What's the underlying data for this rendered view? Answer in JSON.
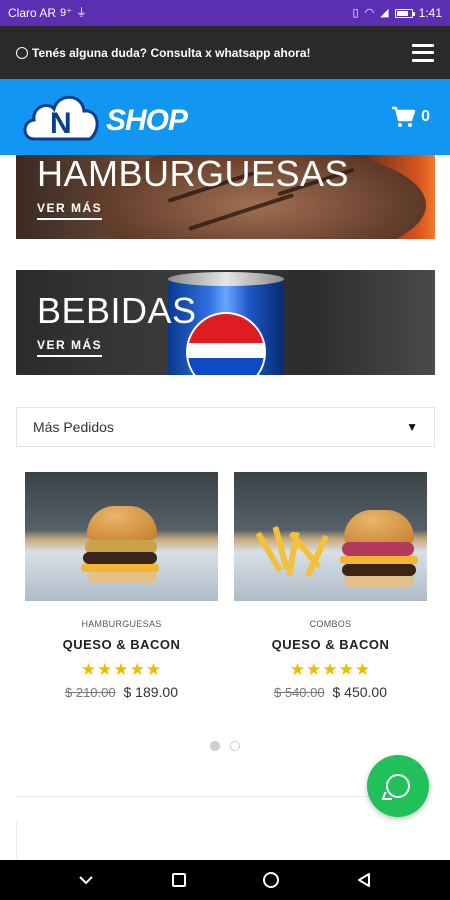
{
  "status_bar": {
    "carrier": "Claro AR",
    "time": "1:41"
  },
  "topbar": {
    "message": "Tenés alguna duda? Consulta x whatsapp ahora!",
    "menu_icon": "hamburger-menu-icon"
  },
  "header": {
    "logo_letter": "N",
    "logo_word": "SHOP",
    "cart_icon": "cart-icon",
    "cart_count": "0"
  },
  "banners": [
    {
      "title": "HAMBURGUESAS",
      "link": "VER MÁS"
    },
    {
      "title": "BEBIDAS",
      "link": "VER MÁS"
    }
  ],
  "sort": {
    "selected": "Más Pedidos"
  },
  "products": [
    {
      "category": "HAMBURGUESAS",
      "name": "QUESO & BACON",
      "stars": "★★★★★",
      "old_price": "$ 210.00",
      "price": "$ 189.00"
    },
    {
      "category": "COMBOS",
      "name": "QUESO & BACON",
      "stars": "★★★★★",
      "old_price": "$ 540.00",
      "price": "$ 450.00"
    }
  ],
  "carousel": {
    "pages": 2,
    "active": 1
  },
  "colors": {
    "status": "#5b2fb2",
    "topbar": "#2a2a2a",
    "brand_blue": "#1196f2",
    "whatsapp_green": "#22c05a",
    "star": "#f5b800"
  }
}
